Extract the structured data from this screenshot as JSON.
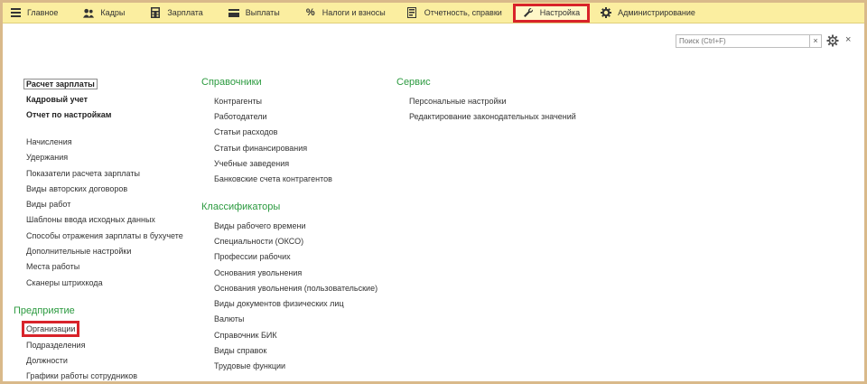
{
  "nav": {
    "tabs": [
      {
        "label": "Главное",
        "icon": "menu-icon"
      },
      {
        "label": "Кадры",
        "icon": "people-icon"
      },
      {
        "label": "Зарплата",
        "icon": "calculator-icon"
      },
      {
        "label": "Выплаты",
        "icon": "card-icon"
      },
      {
        "label": "Налоги и взносы",
        "icon": "percent-icon"
      },
      {
        "label": "Отчетность, справки",
        "icon": "report-icon"
      },
      {
        "label": "Настройка",
        "icon": "wrench-icon",
        "active": true
      },
      {
        "label": "Администрирование",
        "icon": "gear-icon"
      }
    ]
  },
  "toolbar": {
    "search_placeholder": "Поиск (Ctrl+F)",
    "clear_label": "×",
    "close_label": "×"
  },
  "col1": {
    "top": [
      "Расчет зарплаты",
      "Кадровый учет",
      "Отчет по настройкам"
    ],
    "items": [
      "Начисления",
      "Удержания",
      "Показатели расчета зарплаты",
      "Виды авторских договоров",
      "Виды работ",
      "Шаблоны ввода исходных данных",
      "Способы отражения зарплаты в бухучете",
      "Дополнительные настройки",
      "Места работы",
      "Сканеры штрихкода"
    ],
    "enterprise_header": "Предприятие",
    "enterprise_items": [
      "Организации",
      "Подразделения",
      "Должности",
      "Графики работы сотрудников"
    ]
  },
  "col2": {
    "ref_header": "Справочники",
    "ref_items": [
      "Контрагенты",
      "Работодатели",
      "Статьи расходов",
      "Статьи финансирования",
      "Учебные заведения",
      "Банковские счета контрагентов"
    ],
    "cls_header": "Классификаторы",
    "cls_items": [
      "Виды рабочего времени",
      "Специальности (ОКСО)",
      "Профессии рабочих",
      "Основания увольнения",
      "Основания увольнения (пользовательские)",
      "Виды документов физических лиц",
      "Валюты",
      "Справочник БИК",
      "Виды справок",
      "Трудовые функции"
    ]
  },
  "col3": {
    "svc_header": "Сервис",
    "svc_items": [
      "Персональные настройки",
      "Редактирование законодательных значений"
    ]
  },
  "colors": {
    "accent_green": "#2b9a3f",
    "highlight_red": "#d8232a",
    "topbar_bg": "#fbeea0"
  }
}
